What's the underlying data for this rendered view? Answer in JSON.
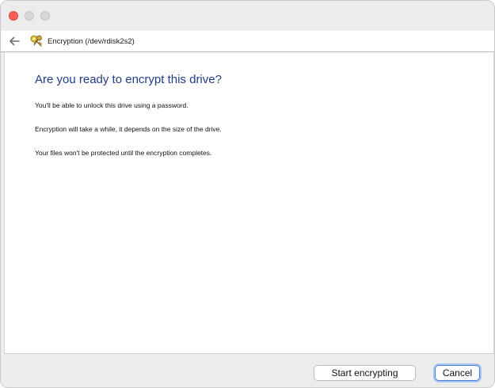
{
  "window": {
    "controls": [
      "close-button",
      "minimize-button",
      "zoom-button"
    ]
  },
  "navbar": {
    "back_icon": "arrow-left-icon",
    "title_icon": "keys-icon",
    "title": "Encryption (/dev/rdisk2s2)"
  },
  "main": {
    "heading": "Are you ready to encrypt this drive?",
    "paragraphs": [
      "You'll be able to unlock this drive using a password.",
      "Encryption will take a while, it depends on the size of the drive.",
      "Your files won't be protected until the encryption completes."
    ]
  },
  "footer": {
    "start_label": "Start encrypting",
    "cancel_label": "Cancel"
  },
  "colors": {
    "heading": "#1f3d8a",
    "close": "#fe5f57",
    "focus_ring": "#4a7fd6"
  }
}
